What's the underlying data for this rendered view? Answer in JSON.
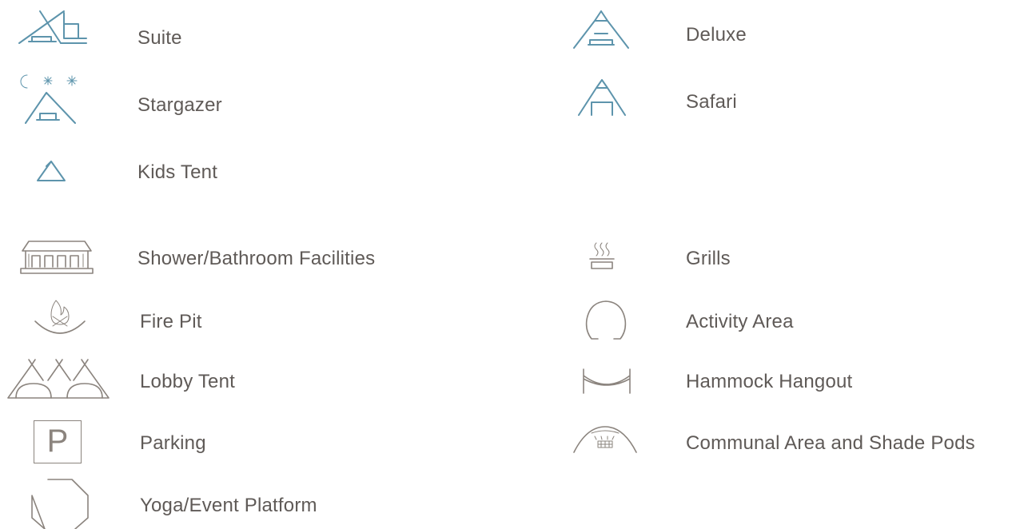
{
  "colors": {
    "accommodation": "#5d94ac",
    "amenity": "#8b847e",
    "text": "#5f5a57"
  },
  "accommodations": {
    "suite": {
      "label": "Suite",
      "icon": "suite-tent-icon"
    },
    "deluxe": {
      "label": "Deluxe",
      "icon": "deluxe-tent-icon"
    },
    "stargazer": {
      "label": "Stargazer",
      "icon": "stargazer-tent-icon"
    },
    "safari": {
      "label": "Safari",
      "icon": "safari-tent-icon"
    },
    "kids_tent": {
      "label": "Kids Tent",
      "icon": "kids-tent-icon"
    }
  },
  "amenities": {
    "shower": {
      "label": "Shower/Bathroom Facilities",
      "icon": "bathhouse-icon"
    },
    "grills": {
      "label": "Grills",
      "icon": "grill-icon"
    },
    "fire_pit": {
      "label": "Fire Pit",
      "icon": "fire-pit-icon"
    },
    "activity_area": {
      "label": "Activity Area",
      "icon": "activity-area-icon"
    },
    "lobby_tent": {
      "label": "Lobby Tent",
      "icon": "lobby-tent-icon"
    },
    "hammock": {
      "label": "Hammock Hangout",
      "icon": "hammock-icon"
    },
    "parking": {
      "label": "Parking",
      "icon": "parking-icon",
      "glyph": "P"
    },
    "communal": {
      "label": "Communal Area and Shade Pods",
      "icon": "shade-pod-icon"
    },
    "yoga": {
      "label": "Yoga/Event Platform",
      "icon": "octagon-platform-icon"
    }
  }
}
